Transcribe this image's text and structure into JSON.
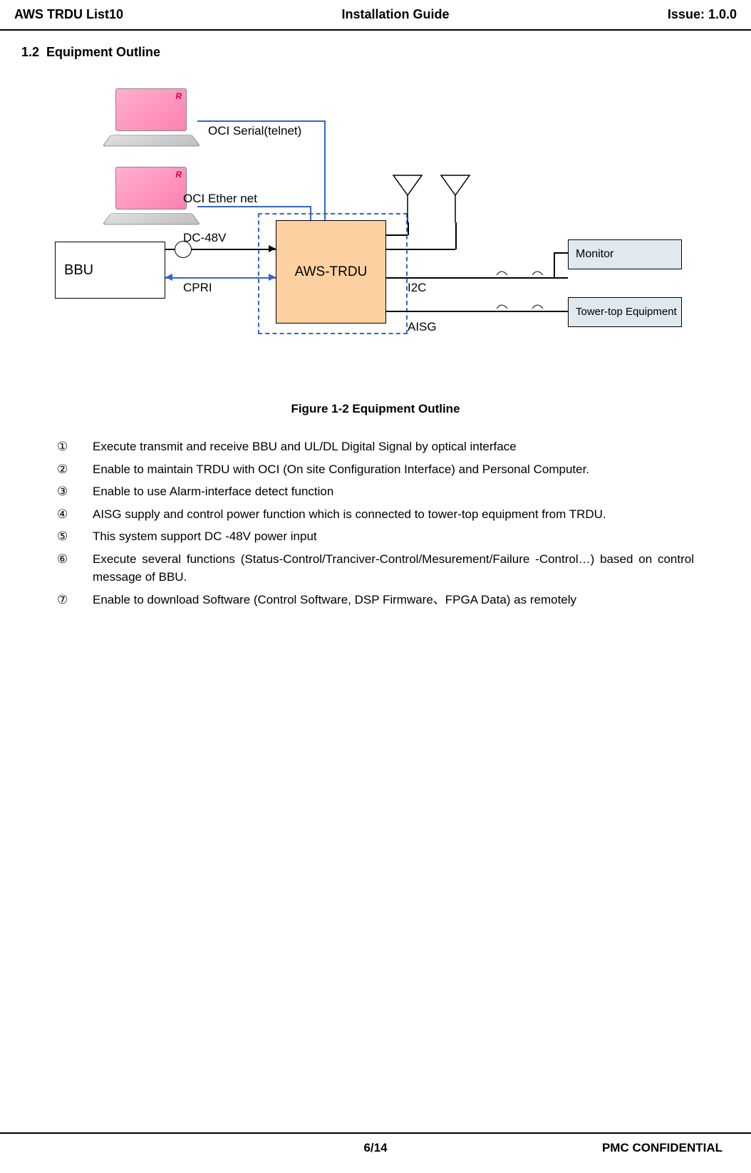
{
  "header": {
    "left": "AWS TRDU List10",
    "center": "Installation Guide",
    "right": "Issue: 1.0.0"
  },
  "section": {
    "number": "1.2",
    "title": "Equipment Outline"
  },
  "diagram": {
    "bbu": "BBU",
    "aws_trdu": "AWS-TRDU",
    "monitor": "Monitor",
    "tower": "Tower-top Equipment",
    "oci_serial": "OCI  Serial(telnet)",
    "oci_ether": "OCI Ether net",
    "dc48v": "DC-48V",
    "cpri": "CPRI",
    "i2c": "I2C",
    "aisg": "AISG"
  },
  "figure_caption": "Figure 1-2 Equipment Outline",
  "list": [
    {
      "marker": "①",
      "text": "Execute transmit and receive BBU and UL/DL Digital Signal by optical interface"
    },
    {
      "marker": "②",
      "text": "Enable to maintain TRDU with OCI (On site Configuration Interface) and Personal Computer."
    },
    {
      "marker": "③",
      "text": "Enable to use Alarm-interface detect function"
    },
    {
      "marker": "④",
      "text": "AISG supply and control power function which is connected to tower-top equipment from TRDU."
    },
    {
      "marker": "⑤",
      "text": "This system support    DC -48V power input"
    },
    {
      "marker": "⑥",
      "text": "Execute several functions (Status-Control/Tranciver-Control/Mesurement/Failure -Control…) based on control message of BBU."
    },
    {
      "marker": "⑦",
      "text": "Enable to download Software (Control Software, DSP Firmware、FPGA Data) as remotely"
    }
  ],
  "footer": {
    "page": "6/14",
    "confidential": "PMC CONFIDENTIAL"
  }
}
